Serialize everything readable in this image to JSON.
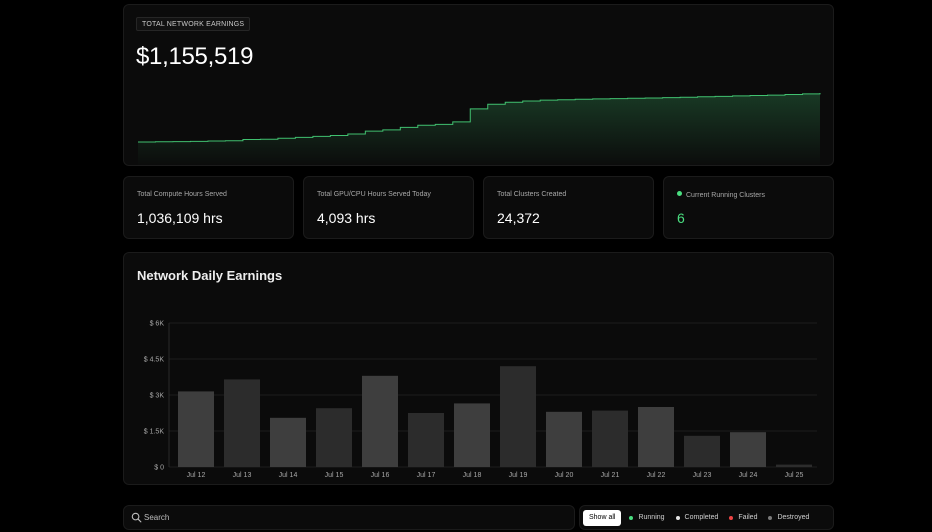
{
  "network_earnings": {
    "badge": "TOTAL NETWORK EARNINGS",
    "total": "$1,155,519"
  },
  "stats": [
    {
      "label": "Total Compute Hours Served",
      "value": "1,036,109 hrs"
    },
    {
      "label": "Total GPU/CPU Hours Served Today",
      "value": "4,093 hrs"
    },
    {
      "label": "Total Clusters Created",
      "value": "24,372"
    },
    {
      "label": "Current Running Clusters",
      "value": "6"
    }
  ],
  "daily": {
    "title": "Network Daily Earnings"
  },
  "chart_data": [
    {
      "type": "area",
      "color": "#4ade80",
      "values": [
        100,
        101,
        102,
        103,
        105,
        106,
        112,
        113,
        118,
        122,
        127,
        131,
        138,
        152,
        158,
        170,
        180,
        184,
        196,
        258,
        280,
        290,
        296,
        300,
        302,
        304,
        306,
        307,
        309,
        310,
        312,
        314,
        316,
        318,
        320,
        322,
        324,
        327,
        330,
        334
      ]
    },
    {
      "type": "bar",
      "title": "Network Daily Earnings",
      "categories": [
        "Jul 12",
        "Jul 13",
        "Jul 14",
        "Jul 15",
        "Jul 16",
        "Jul 17",
        "Jul 18",
        "Jul 19",
        "Jul 20",
        "Jul 21",
        "Jul 22",
        "Jul 23",
        "Jul 24",
        "Jul 25"
      ],
      "values": [
        3150,
        3650,
        2050,
        2450,
        3800,
        2250,
        2650,
        4200,
        2300,
        2350,
        2500,
        1300,
        1450,
        100
      ],
      "colors": [
        "#3e3e3e",
        "#2c2c2c",
        "#3e3e3e",
        "#2c2c2c",
        "#3e3e3e",
        "#2c2c2c",
        "#3e3e3e",
        "#2c2c2c",
        "#3e3e3e",
        "#2c2c2c",
        "#3e3e3e",
        "#2c2c2c",
        "#3e3e3e",
        "#2c2c2c"
      ],
      "y_ticks": [
        0,
        1500,
        3000,
        4500,
        6000
      ],
      "y_tick_labels": [
        "$ 0",
        "$ 1.5K",
        "$ 3K",
        "$ 4.5K",
        "$ 6K"
      ],
      "ylim": [
        0,
        6000
      ],
      "grid": true
    }
  ],
  "search": {
    "placeholder": "Search"
  },
  "filters": {
    "show_all": "Show all",
    "items": [
      {
        "label": "Running",
        "color": "#4ade80"
      },
      {
        "label": "Completed",
        "color": "#e5e5e5"
      },
      {
        "label": "Failed",
        "color": "#ef4444"
      },
      {
        "label": "Destroyed",
        "color": "#7a7a7a"
      }
    ]
  }
}
